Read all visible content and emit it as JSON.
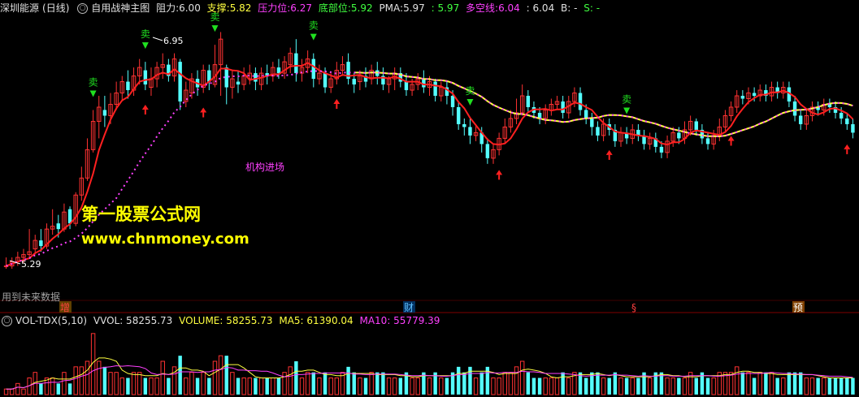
{
  "header": {
    "stock": "深圳能源",
    "period": "(日线)",
    "indicator": "自用战神主图",
    "resistance_label": "阻力:",
    "resistance_value": "6.00",
    "support_label": "支撑:",
    "support_value": "5.82",
    "pressure_label": "压力位:",
    "pressure_value": "6.27",
    "bottom_label": "底部位:",
    "bottom_value": "5.92",
    "pma_label": "PMA:",
    "pma_value": "5.97",
    "p2_value": ": 5.97",
    "dk_label": "多空线:",
    "dk_value": "6.04",
    "p3_value": ": 6.04",
    "b_label": "B: -",
    "s_label": "S: -"
  },
  "vol_header": {
    "name": "VOL-TDX(5,10)",
    "vvol": "VVOL: 58255.73",
    "volume": "VOLUME: 58255.73",
    "ma5": "MA5: 61390.04",
    "ma10": "MA10: 55779.39"
  },
  "labels": {
    "high_price": "6.95",
    "low_price": "5.29",
    "institution": "机构进场",
    "future_data": "用到未来数据",
    "sell": "卖",
    "buy": "买",
    "watermark1": "第一股票公式网",
    "watermark2": "www.chnmoney.com",
    "marker_increase": "增",
    "marker_finance": "财",
    "marker_s": "§",
    "marker_forecast": "预"
  },
  "colors": {
    "up": "#ff3232",
    "down": "#54ffff",
    "white_line": "#ffffff",
    "red_line": "#ff2020",
    "green_line": "#20d020",
    "yellow_line": "#ffff40",
    "magenta": "#ff40ff",
    "sell": "#20e020",
    "buy_arrow": "#ff2020"
  },
  "chart_data": {
    "type": "candlestick",
    "ylim": [
      5.2,
      7.05
    ],
    "annotations": {
      "max": 6.95,
      "min": 5.29
    },
    "candles": [
      [
        5.3,
        5.3,
        5.36,
        5.28,
        1
      ],
      [
        5.3,
        5.33,
        5.36,
        5.28,
        1
      ],
      [
        5.33,
        5.36,
        5.4,
        5.3,
        2
      ],
      [
        5.36,
        5.38,
        5.42,
        5.32,
        1
      ],
      [
        5.38,
        5.4,
        5.56,
        5.36,
        3
      ],
      [
        5.42,
        5.48,
        5.52,
        5.38,
        4
      ],
      [
        5.48,
        5.44,
        5.56,
        5.4,
        2
      ],
      [
        5.44,
        5.56,
        5.6,
        5.42,
        3
      ],
      [
        5.56,
        5.58,
        5.7,
        5.52,
        3
      ],
      [
        5.6,
        5.56,
        5.66,
        5.5,
        2
      ],
      [
        5.56,
        5.68,
        5.74,
        5.54,
        4
      ],
      [
        5.7,
        5.6,
        5.72,
        5.56,
        2
      ],
      [
        5.6,
        5.8,
        5.82,
        5.58,
        5
      ],
      [
        5.8,
        5.92,
        6.0,
        5.76,
        5
      ],
      [
        5.92,
        6.12,
        6.2,
        5.9,
        6
      ],
      [
        6.12,
        6.32,
        6.4,
        6.1,
        11
      ],
      [
        6.32,
        6.42,
        6.5,
        6.2,
        6
      ],
      [
        6.4,
        6.36,
        6.5,
        6.28,
        5
      ],
      [
        6.36,
        6.44,
        6.52,
        6.3,
        4
      ],
      [
        6.44,
        6.52,
        6.6,
        6.4,
        4
      ],
      [
        6.52,
        6.6,
        6.64,
        6.46,
        3
      ],
      [
        6.6,
        6.54,
        6.68,
        6.48,
        3
      ],
      [
        6.54,
        6.64,
        6.7,
        6.5,
        4
      ],
      [
        6.64,
        6.7,
        6.76,
        6.58,
        4
      ],
      [
        6.68,
        6.58,
        6.74,
        6.54,
        3
      ],
      [
        6.56,
        6.62,
        6.7,
        6.5,
        3
      ],
      [
        6.62,
        6.7,
        6.74,
        6.56,
        3
      ],
      [
        6.7,
        6.72,
        6.8,
        6.62,
        6
      ],
      [
        6.72,
        6.64,
        6.76,
        6.6,
        3
      ],
      [
        6.64,
        6.76,
        6.8,
        6.6,
        5
      ],
      [
        6.74,
        6.46,
        6.76,
        6.4,
        7
      ],
      [
        6.46,
        6.54,
        6.6,
        6.42,
        3
      ],
      [
        6.52,
        6.62,
        6.66,
        6.48,
        4
      ],
      [
        6.62,
        6.56,
        6.68,
        6.5,
        3
      ],
      [
        6.56,
        6.68,
        6.72,
        6.52,
        4
      ],
      [
        6.68,
        6.6,
        6.72,
        6.54,
        3
      ],
      [
        6.58,
        6.72,
        6.86,
        6.56,
        6
      ],
      [
        6.72,
        6.9,
        6.95,
        6.5,
        7
      ],
      [
        6.7,
        6.56,
        6.72,
        6.44,
        7
      ],
      [
        6.56,
        6.62,
        6.68,
        6.48,
        4
      ],
      [
        6.6,
        6.58,
        6.68,
        6.52,
        3
      ],
      [
        6.58,
        6.64,
        6.7,
        6.54,
        3
      ],
      [
        6.62,
        6.66,
        6.72,
        6.58,
        3
      ],
      [
        6.66,
        6.6,
        6.7,
        6.54,
        3
      ],
      [
        6.58,
        6.66,
        6.7,
        6.54,
        3
      ],
      [
        6.66,
        6.64,
        6.72,
        6.58,
        3
      ],
      [
        6.64,
        6.7,
        6.74,
        6.6,
        3
      ],
      [
        6.7,
        6.66,
        6.76,
        6.62,
        3
      ],
      [
        6.66,
        6.74,
        6.78,
        6.62,
        4
      ],
      [
        6.72,
        6.8,
        6.84,
        6.66,
        5
      ],
      [
        6.8,
        6.66,
        6.9,
        6.6,
        6
      ],
      [
        6.66,
        6.7,
        6.76,
        6.6,
        3
      ],
      [
        6.7,
        6.76,
        6.82,
        6.66,
        4
      ],
      [
        6.76,
        6.62,
        6.8,
        6.56,
        4
      ],
      [
        6.62,
        6.66,
        6.72,
        6.58,
        3
      ],
      [
        6.66,
        6.56,
        6.7,
        6.52,
        4
      ],
      [
        6.56,
        6.62,
        6.66,
        6.52,
        3
      ],
      [
        6.62,
        6.68,
        6.74,
        6.58,
        3
      ],
      [
        6.68,
        6.72,
        6.78,
        6.64,
        4
      ],
      [
        6.74,
        6.62,
        6.8,
        6.58,
        5
      ],
      [
        6.62,
        6.58,
        6.66,
        6.52,
        4
      ],
      [
        6.6,
        6.64,
        6.68,
        6.54,
        3
      ],
      [
        6.64,
        6.6,
        6.7,
        6.56,
        3
      ],
      [
        6.62,
        6.68,
        6.72,
        6.58,
        4
      ],
      [
        6.68,
        6.64,
        6.74,
        6.58,
        4
      ],
      [
        6.64,
        6.58,
        6.7,
        6.54,
        4
      ],
      [
        6.58,
        6.62,
        6.64,
        6.52,
        3
      ],
      [
        6.62,
        6.66,
        6.7,
        6.54,
        3
      ],
      [
        6.66,
        6.6,
        6.7,
        6.56,
        3
      ],
      [
        6.6,
        6.54,
        6.66,
        6.5,
        4
      ],
      [
        6.54,
        6.58,
        6.62,
        6.5,
        3
      ],
      [
        6.58,
        6.62,
        6.66,
        6.54,
        3
      ],
      [
        6.62,
        6.56,
        6.68,
        6.52,
        4
      ],
      [
        6.56,
        6.6,
        6.64,
        6.5,
        3
      ],
      [
        6.6,
        6.5,
        6.62,
        6.46,
        4
      ],
      [
        6.5,
        6.56,
        6.6,
        6.46,
        3
      ],
      [
        6.56,
        6.5,
        6.6,
        6.44,
        3
      ],
      [
        6.5,
        6.42,
        6.54,
        6.36,
        4
      ],
      [
        6.42,
        6.3,
        6.46,
        6.26,
        5
      ],
      [
        6.3,
        6.28,
        6.34,
        6.22,
        4
      ],
      [
        6.28,
        6.22,
        6.34,
        6.16,
        5
      ],
      [
        6.22,
        6.24,
        6.3,
        6.18,
        3
      ],
      [
        6.24,
        6.16,
        6.28,
        6.1,
        4
      ],
      [
        6.16,
        6.06,
        6.2,
        6.02,
        5
      ],
      [
        6.06,
        6.12,
        6.16,
        6.02,
        3
      ],
      [
        6.12,
        6.2,
        6.24,
        6.08,
        3
      ],
      [
        6.2,
        6.28,
        6.34,
        6.16,
        4
      ],
      [
        6.28,
        6.34,
        6.4,
        6.24,
        4
      ],
      [
        6.34,
        6.38,
        6.48,
        6.3,
        5
      ],
      [
        6.38,
        6.5,
        6.58,
        6.36,
        6
      ],
      [
        6.5,
        6.42,
        6.54,
        6.38,
        4
      ],
      [
        6.42,
        6.38,
        6.46,
        6.34,
        3
      ],
      [
        6.38,
        6.34,
        6.42,
        6.3,
        3
      ],
      [
        6.34,
        6.4,
        6.44,
        6.3,
        3
      ],
      [
        6.4,
        6.44,
        6.48,
        6.36,
        3
      ],
      [
        6.44,
        6.46,
        6.5,
        6.4,
        3
      ],
      [
        6.46,
        6.38,
        6.5,
        6.34,
        4
      ],
      [
        6.38,
        6.46,
        6.5,
        6.34,
        3
      ],
      [
        6.46,
        6.52,
        6.56,
        6.42,
        4
      ],
      [
        6.52,
        6.4,
        6.56,
        6.36,
        4
      ],
      [
        6.4,
        6.34,
        6.44,
        6.3,
        3
      ],
      [
        6.34,
        6.28,
        6.38,
        6.22,
        4
      ],
      [
        6.28,
        6.22,
        6.32,
        6.18,
        4
      ],
      [
        6.22,
        6.3,
        6.34,
        6.18,
        3
      ],
      [
        6.3,
        6.26,
        6.34,
        6.22,
        3
      ],
      [
        6.26,
        6.18,
        6.3,
        6.14,
        4
      ],
      [
        6.18,
        6.24,
        6.28,
        6.14,
        3
      ],
      [
        6.24,
        6.2,
        6.28,
        6.16,
        3
      ],
      [
        6.2,
        6.26,
        6.3,
        6.16,
        3
      ],
      [
        6.26,
        6.22,
        6.3,
        6.18,
        3
      ],
      [
        6.22,
        6.16,
        6.26,
        6.12,
        4
      ],
      [
        6.16,
        6.2,
        6.24,
        6.12,
        3
      ],
      [
        6.2,
        6.14,
        6.24,
        6.1,
        4
      ],
      [
        6.14,
        6.1,
        6.18,
        6.06,
        4
      ],
      [
        6.1,
        6.18,
        6.22,
        6.06,
        3
      ],
      [
        6.18,
        6.24,
        6.28,
        6.14,
        3
      ],
      [
        6.24,
        6.2,
        6.28,
        6.16,
        3
      ],
      [
        6.2,
        6.26,
        6.32,
        6.16,
        3
      ],
      [
        6.26,
        6.32,
        6.36,
        6.22,
        4
      ],
      [
        6.32,
        6.26,
        6.34,
        6.22,
        3
      ],
      [
        6.26,
        6.2,
        6.3,
        6.16,
        4
      ],
      [
        6.2,
        6.16,
        6.24,
        6.12,
        3
      ],
      [
        6.16,
        6.22,
        6.26,
        6.12,
        3
      ],
      [
        6.22,
        6.28,
        6.34,
        6.18,
        4
      ],
      [
        6.28,
        6.36,
        6.4,
        6.24,
        4
      ],
      [
        6.36,
        6.42,
        6.46,
        6.32,
        4
      ],
      [
        6.42,
        6.5,
        6.54,
        6.38,
        5
      ],
      [
        6.5,
        6.48,
        6.54,
        6.44,
        4
      ],
      [
        6.48,
        6.52,
        6.56,
        6.44,
        4
      ],
      [
        6.52,
        6.5,
        6.56,
        6.46,
        3
      ],
      [
        6.5,
        6.54,
        6.58,
        6.46,
        4
      ],
      [
        6.54,
        6.5,
        6.58,
        6.46,
        4
      ],
      [
        6.5,
        6.56,
        6.6,
        6.46,
        4
      ],
      [
        6.56,
        6.52,
        6.6,
        6.48,
        3
      ],
      [
        6.52,
        6.56,
        6.6,
        6.48,
        3
      ],
      [
        6.56,
        6.46,
        6.6,
        6.42,
        4
      ],
      [
        6.46,
        6.36,
        6.5,
        6.32,
        4
      ],
      [
        6.36,
        6.3,
        6.4,
        6.26,
        4
      ],
      [
        6.3,
        6.36,
        6.4,
        6.26,
        3
      ],
      [
        6.36,
        6.42,
        6.46,
        6.32,
        3
      ],
      [
        6.42,
        6.4,
        6.46,
        6.36,
        3
      ],
      [
        6.4,
        6.44,
        6.48,
        6.36,
        3
      ],
      [
        6.44,
        6.42,
        6.48,
        6.38,
        3
      ],
      [
        6.42,
        6.38,
        6.46,
        6.34,
        3
      ],
      [
        6.38,
        6.34,
        6.42,
        6.3,
        3
      ],
      [
        6.34,
        6.3,
        6.38,
        6.26,
        3
      ],
      [
        6.3,
        6.24,
        6.34,
        6.2,
        3
      ]
    ],
    "volume_ylim": [
      0,
      12
    ]
  }
}
